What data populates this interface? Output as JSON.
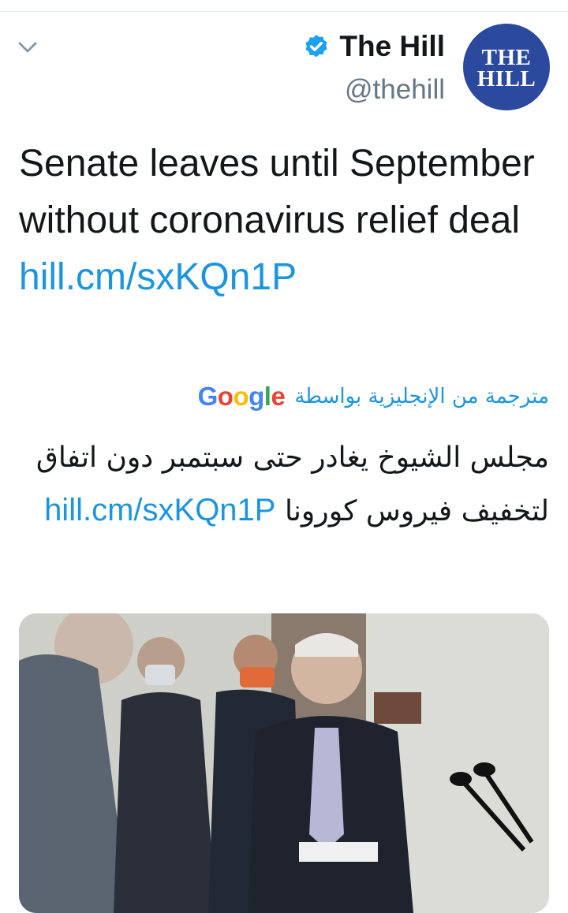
{
  "account": {
    "display_name": "The Hill",
    "handle": "@thehill",
    "avatar_line1": "THE",
    "avatar_line2": "HILL",
    "verified": true
  },
  "tweet": {
    "text": "Senate leaves until September without coronavirus relief deal",
    "link": "hill.cm/sxKQn1P"
  },
  "translation": {
    "label": "مترجمة من الإنجليزية بواسطة",
    "provider": "Google",
    "text_part1": "مجلس الشيوخ يغادر حتى سبتمبر دون اتفاق لتخفيف فيروس كورونا",
    "link": "hill.cm/sxKQn1P"
  },
  "media": {
    "description": "photo-senators-press-conference"
  },
  "icons": {
    "menu": "chevron-down-icon",
    "verified": "verified-badge-icon"
  },
  "colors": {
    "link": "#1b95e0",
    "verified": "#1da1f2",
    "avatar_bg": "#2b4a9e",
    "text": "#14171a",
    "secondary": "#657786"
  }
}
